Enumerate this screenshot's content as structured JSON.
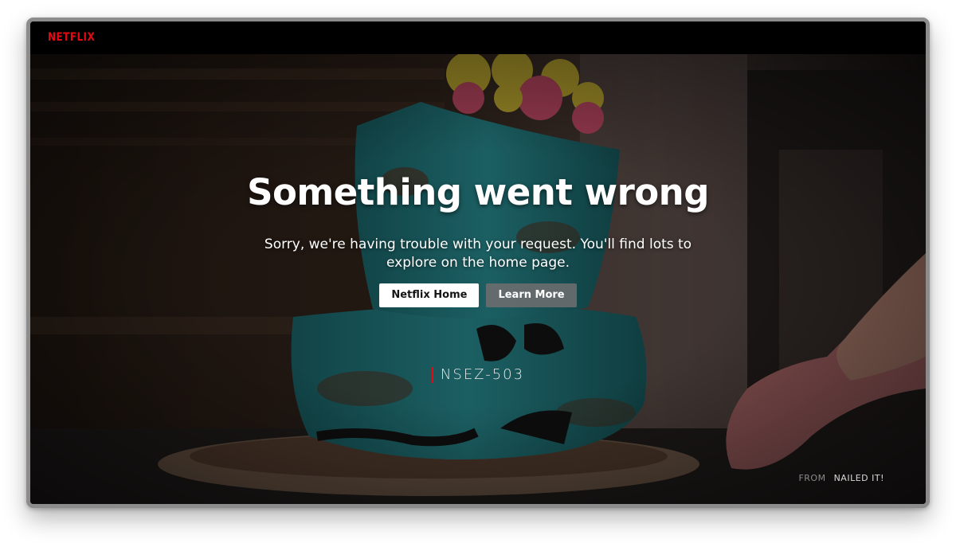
{
  "header": {
    "logo_text": "NETFLIX"
  },
  "error": {
    "title": "Something went wrong",
    "message": "Sorry, we're having trouble with your request. You'll find lots to explore on the home page.",
    "code": "NSEZ-503"
  },
  "buttons": {
    "home_label": "Netflix Home",
    "learn_more_label": "Learn More"
  },
  "background_credit": {
    "from_label": "FROM",
    "show_title": "NAILED IT!"
  },
  "colors": {
    "brand_red": "#e50914",
    "primary_button_bg": "#ffffff",
    "secondary_button_bg": "#6d6d6e"
  }
}
